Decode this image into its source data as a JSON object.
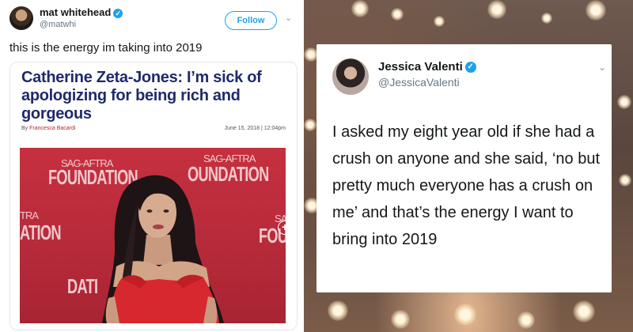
{
  "left_tweet": {
    "user_name": "mat whitehead",
    "handle": "@matwhi",
    "follow_label": "Follow",
    "text": "this is the energy im taking into 2019",
    "article": {
      "headline": "Catherine Zeta-Jones: I’m sick of apologizing for being rich and gorgeous",
      "byline_prefix": "By",
      "author": "Francesca Bacardi",
      "date": "June 15, 2018",
      "time": "12:04pm",
      "date_separator": "|"
    },
    "backdrop_text": {
      "sag_aftra": "SAG-AFTRA",
      "foundation_1": "FOUNDATION",
      "foundation_2": "OUNDATION",
      "tra": "TRA",
      "ation": "ATION",
      "sag": "SAG",
      "foun": "FOUN",
      "dati": "DATI"
    }
  },
  "right_tweet": {
    "user_name": "Jessica Valenti",
    "handle": "@JessicaValenti",
    "text": "I asked my eight year old if she had a crush on anyone and she said, ‘no but pretty much everyone has a crush on me’ and that’s the energy I want to bring into 2019"
  },
  "icons": {
    "verified": "✓",
    "chevron": "⌄",
    "plus": "+"
  },
  "colors": {
    "twitter_blue": "#1da1f2",
    "headline_navy": "#1f2a6b",
    "backdrop_red": "#c6303f"
  }
}
